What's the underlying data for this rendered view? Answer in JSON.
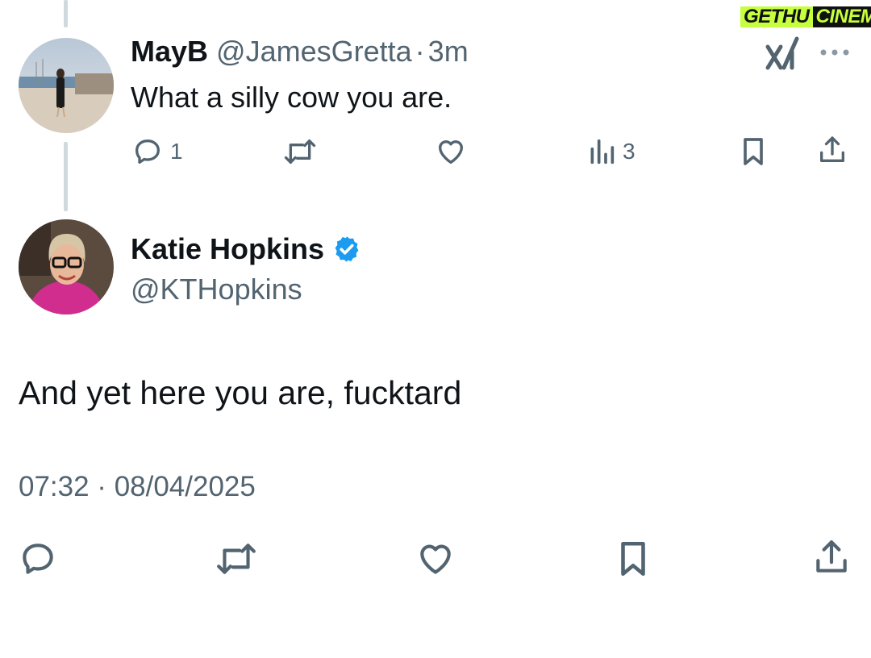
{
  "watermark": {
    "part1": "GETHU",
    "part2": "CINEMA"
  },
  "reply": {
    "display_name": "MayB",
    "handle": "@JamesGretta",
    "separator": "·",
    "time": "3m",
    "text": "What a silly cow you are.",
    "reply_count": "1",
    "view_count": "3"
  },
  "main_tweet": {
    "display_name": "Katie Hopkins",
    "handle": "@KTHopkins",
    "text": "And yet here you are, fucktard",
    "timestamp": "07:32 · 08/04/2025"
  },
  "colors": {
    "text": "#0f1419",
    "muted": "#536471",
    "verified": "#1d9bf0",
    "thread_line": "#cfd9de"
  }
}
